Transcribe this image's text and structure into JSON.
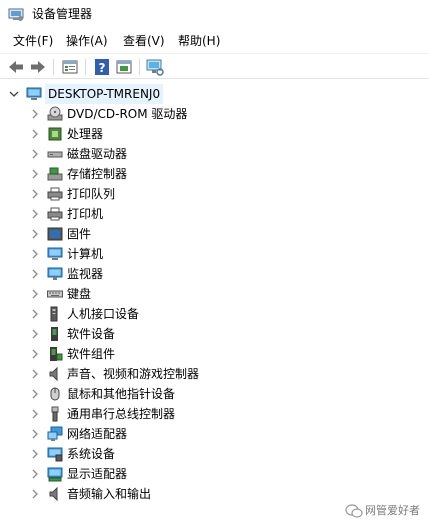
{
  "window": {
    "title": "设备管理器"
  },
  "menu": [
    "文件(F)",
    "操作(A)",
    "查看(V)",
    "帮助(H)"
  ],
  "toolbar": {
    "icons": [
      "back-arrow-icon",
      "forward-arrow-icon",
      "properties-icon",
      "help-icon",
      "update-driver-icon",
      "monitor-scan-icon"
    ]
  },
  "tree": {
    "root": "DESKTOP-TMRENJ0",
    "items": [
      {
        "label": "DVD/CD-ROM 驱动器",
        "icon": "dvd-drive-icon"
      },
      {
        "label": "处理器",
        "icon": "processor-icon"
      },
      {
        "label": "磁盘驱动器",
        "icon": "disk-drive-icon"
      },
      {
        "label": "存储控制器",
        "icon": "storage-controller-icon"
      },
      {
        "label": "打印队列",
        "icon": "print-queue-icon"
      },
      {
        "label": "打印机",
        "icon": "printer-icon"
      },
      {
        "label": "固件",
        "icon": "firmware-icon"
      },
      {
        "label": "计算机",
        "icon": "computer-icon"
      },
      {
        "label": "监视器",
        "icon": "monitor-icon"
      },
      {
        "label": "键盘",
        "icon": "keyboard-icon"
      },
      {
        "label": "人机接口设备",
        "icon": "hid-icon"
      },
      {
        "label": "软件设备",
        "icon": "software-device-icon"
      },
      {
        "label": "软件组件",
        "icon": "software-component-icon"
      },
      {
        "label": "声音、视频和游戏控制器",
        "icon": "sound-icon"
      },
      {
        "label": "鼠标和其他指针设备",
        "icon": "mouse-icon"
      },
      {
        "label": "通用串行总线控制器",
        "icon": "usb-icon"
      },
      {
        "label": "网络适配器",
        "icon": "network-adapter-icon"
      },
      {
        "label": "系统设备",
        "icon": "system-device-icon"
      },
      {
        "label": "显示适配器",
        "icon": "display-adapter-icon"
      },
      {
        "label": "音频输入和输出",
        "icon": "audio-io-icon"
      }
    ]
  },
  "watermark": {
    "text": "网管爱好者"
  }
}
